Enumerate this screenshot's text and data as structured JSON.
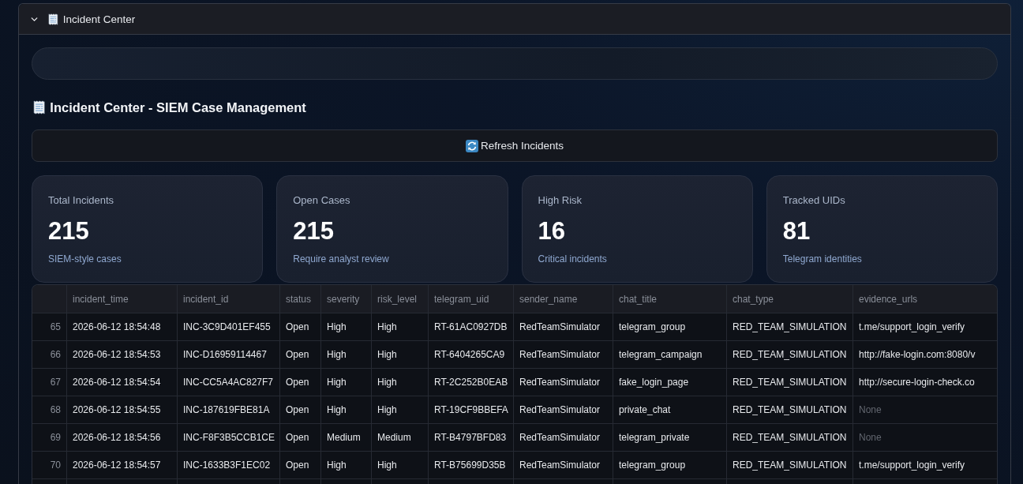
{
  "expander": {
    "title": "Incident Center",
    "expanded": true
  },
  "page_title": "Incident Center - SIEM Case Management",
  "refresh_button": {
    "label": "Refresh Incidents"
  },
  "metrics": [
    {
      "label": "Total Incidents",
      "value": "215",
      "caption": "SIEM-style cases"
    },
    {
      "label": "Open Cases",
      "value": "215",
      "caption": "Require analyst review"
    },
    {
      "label": "High Risk",
      "value": "16",
      "caption": "Critical incidents"
    },
    {
      "label": "Tracked UIDs",
      "value": "81",
      "caption": "Telegram identities"
    }
  ],
  "table": {
    "columns": [
      "incident_time",
      "incident_id",
      "status",
      "severity",
      "risk_level",
      "telegram_uid",
      "sender_name",
      "chat_title",
      "chat_type",
      "evidence_urls"
    ],
    "rows": [
      {
        "index": "65",
        "cells": [
          "2026-06-12 18:54:48",
          "INC-3C9D401EF455",
          "Open",
          "High",
          "High",
          "RT-61AC0927DB",
          "RedTeamSimulator",
          "telegram_group",
          "RED_TEAM_SIMULATION",
          "t.me/support_login_verify"
        ],
        "evidence_missing": false
      },
      {
        "index": "66",
        "cells": [
          "2026-06-12 18:54:53",
          "INC-D16959114467",
          "Open",
          "High",
          "High",
          "RT-6404265CA9",
          "RedTeamSimulator",
          "telegram_campaign",
          "RED_TEAM_SIMULATION",
          "http://fake-login.com:8080/v"
        ],
        "evidence_missing": false
      },
      {
        "index": "67",
        "cells": [
          "2026-06-12 18:54:54",
          "INC-CC5A4AC827F7",
          "Open",
          "High",
          "High",
          "RT-2C252B0EAB",
          "RedTeamSimulator",
          "fake_login_page",
          "RED_TEAM_SIMULATION",
          "http://secure-login-check.co"
        ],
        "evidence_missing": false
      },
      {
        "index": "68",
        "cells": [
          "2026-06-12 18:54:55",
          "INC-187619FBE81A",
          "Open",
          "High",
          "High",
          "RT-19CF9BBEFA",
          "RedTeamSimulator",
          "private_chat",
          "RED_TEAM_SIMULATION",
          "None"
        ],
        "evidence_missing": true
      },
      {
        "index": "69",
        "cells": [
          "2026-06-12 18:54:56",
          "INC-F8F3B5CCB1CE",
          "Open",
          "Medium",
          "Medium",
          "RT-B4797BFD83",
          "RedTeamSimulator",
          "telegram_private",
          "RED_TEAM_SIMULATION",
          "None"
        ],
        "evidence_missing": true
      },
      {
        "index": "70",
        "cells": [
          "2026-06-12 18:54:57",
          "INC-1633B3F1EC02",
          "Open",
          "High",
          "High",
          "RT-B75699D35B",
          "RedTeamSimulator",
          "telegram_group",
          "RED_TEAM_SIMULATION",
          "t.me/support_login_verify"
        ],
        "evidence_missing": false
      }
    ]
  }
}
